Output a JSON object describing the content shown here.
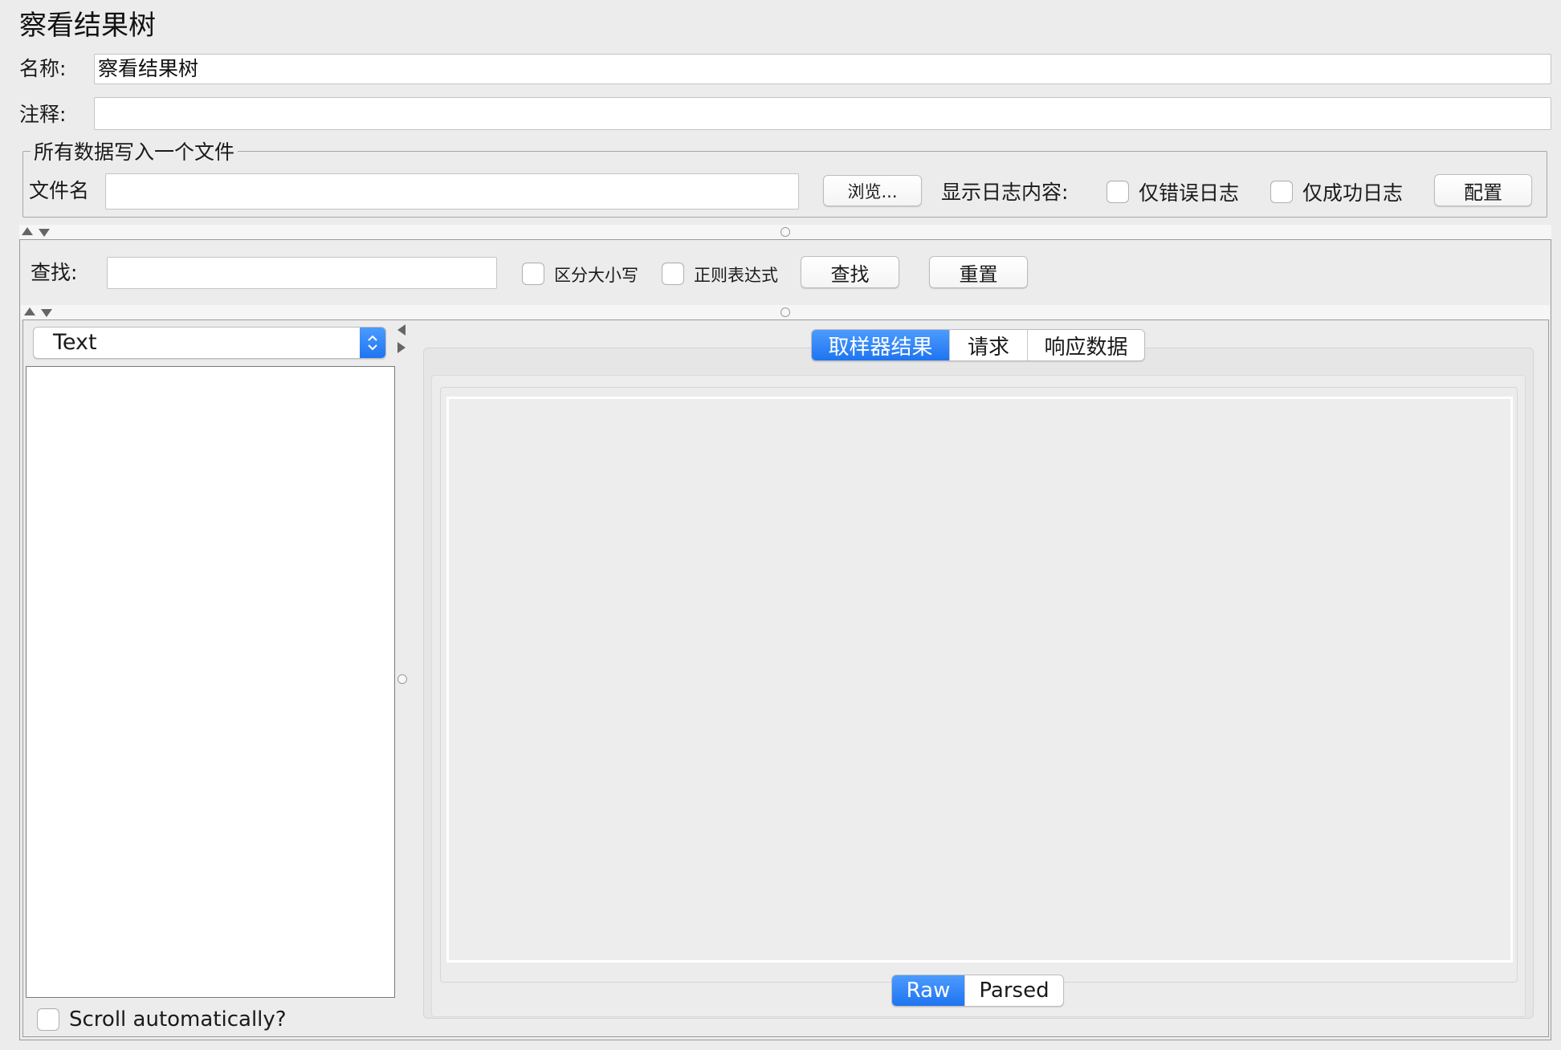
{
  "window": {
    "title": "察看结果树"
  },
  "form": {
    "name_label": "名称:",
    "name_value": "察看结果树",
    "comment_label": "注释:",
    "comment_value": ""
  },
  "file_group": {
    "legend": "所有数据写入一个文件",
    "filename_label": "文件名",
    "filename_value": "",
    "browse_button": "浏览...",
    "log_display_label": "显示日志内容:",
    "errors_only_label": "仅错误日志",
    "success_only_label": "仅成功日志",
    "configure_button": "配置"
  },
  "search": {
    "label": "查找:",
    "value": "",
    "case_sensitive_label": "区分大小写",
    "regex_label": "正则表达式",
    "find_button": "查找",
    "reset_button": "重置"
  },
  "renderer": {
    "selected": "Text"
  },
  "result_tabs": [
    {
      "label": "取样器结果",
      "active": true
    },
    {
      "label": "请求",
      "active": false
    },
    {
      "label": "响应数据",
      "active": false
    }
  ],
  "view_toggle": [
    {
      "label": "Raw",
      "active": true
    },
    {
      "label": "Parsed",
      "active": false
    }
  ],
  "scroll_auto_label": "Scroll automatically?",
  "colors": {
    "accent": "#1f75f0",
    "background": "#ececec"
  }
}
